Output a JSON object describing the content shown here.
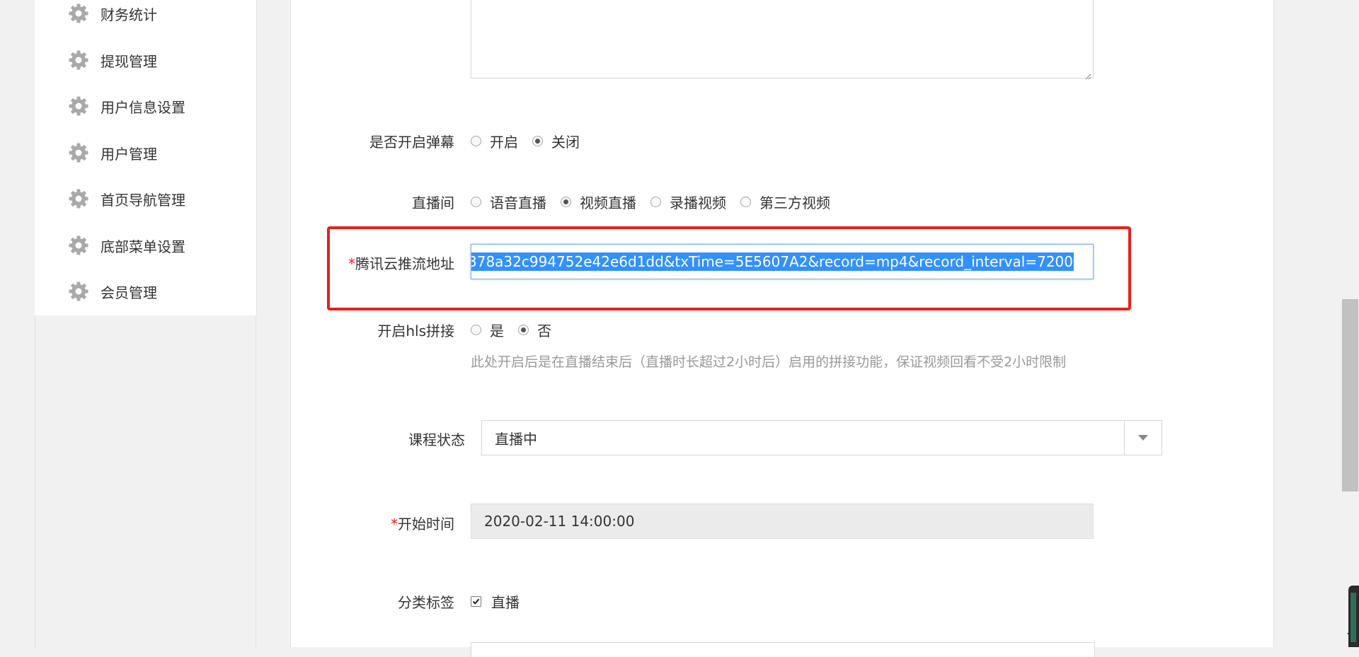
{
  "sidebar": {
    "items": [
      {
        "label": "财务统计"
      },
      {
        "label": "提现管理"
      },
      {
        "label": "用户信息设置"
      },
      {
        "label": "用户管理"
      },
      {
        "label": "首页导航管理"
      },
      {
        "label": "底部菜单设置"
      },
      {
        "label": "会员管理"
      }
    ]
  },
  "form": {
    "danmu": {
      "label": "是否开启弹幕",
      "options": [
        "开启",
        "关闭"
      ],
      "selected": "关闭"
    },
    "live_room": {
      "label": "直播间",
      "options": [
        "语音直播",
        "视频直播",
        "录播视频",
        "第三方视频"
      ],
      "selected": "视频直播"
    },
    "push_url": {
      "required_mark": "*",
      "label": "腾讯云推流地址",
      "value": "378a32c994752e42e6d1dd&txTime=5E5607A2&record=mp4&record_interval=7200"
    },
    "hls": {
      "label": "开启hls拼接",
      "options": [
        "是",
        "否"
      ],
      "selected": "否",
      "hint": "此处开启后是在直播结束后（直播时长超过2小时后）启用的拼接功能，保证视频回看不受2小时限制"
    },
    "course_status": {
      "label": "课程状态",
      "value": "直播中"
    },
    "start_time": {
      "required_mark": "*",
      "label": "开始时间",
      "value": "2020-02-11 14:00:00"
    },
    "category": {
      "label": "分类标签",
      "option": "直播",
      "checked": true
    }
  },
  "colors": {
    "highlight_box": "#e81f1f",
    "selection": "#3390ff",
    "required": "#e02020"
  }
}
